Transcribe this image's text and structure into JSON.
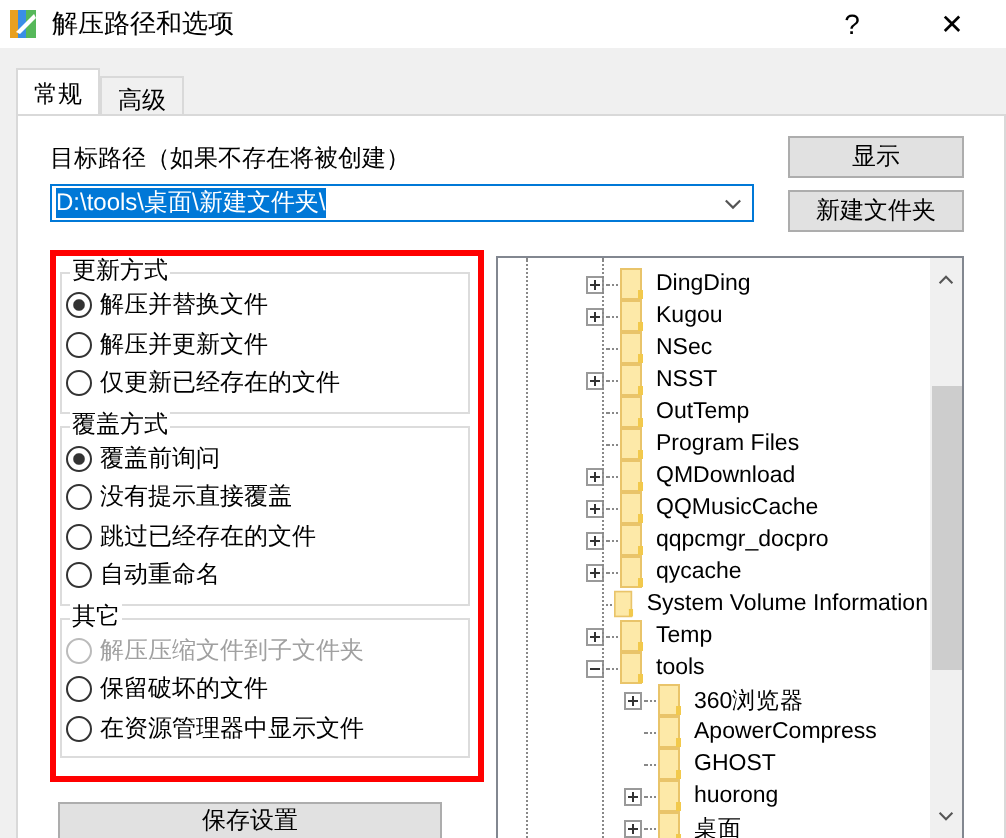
{
  "window": {
    "title": "解压路径和选项",
    "help": "?",
    "close": "✕"
  },
  "tabs": [
    {
      "label": "常规",
      "selected": true
    },
    {
      "label": "高级",
      "selected": false
    }
  ],
  "path": {
    "label": "目标路径（如果不存在将被创建）",
    "value": "D:\\tools\\桌面\\新建文件夹\\"
  },
  "buttons": [
    "显示",
    "新建文件夹"
  ],
  "groups": [
    {
      "title": "更新方式",
      "options": [
        {
          "label": "解压并替换文件",
          "selected": true,
          "disabled": false
        },
        {
          "label": "解压并更新文件",
          "selected": false,
          "disabled": false
        },
        {
          "label": "仅更新已经存在的文件",
          "selected": false,
          "disabled": false
        }
      ]
    },
    {
      "title": "覆盖方式",
      "options": [
        {
          "label": "覆盖前询问",
          "selected": true,
          "disabled": false
        },
        {
          "label": "没有提示直接覆盖",
          "selected": false,
          "disabled": false
        },
        {
          "label": "跳过已经存在的文件",
          "selected": false,
          "disabled": false
        },
        {
          "label": "自动重命名",
          "selected": false,
          "disabled": false
        }
      ]
    },
    {
      "title": "其它",
      "options": [
        {
          "label": "解压压缩文件到子文件夹",
          "selected": false,
          "disabled": true
        },
        {
          "label": "保留破坏的文件",
          "selected": false,
          "disabled": false
        },
        {
          "label": "在资源管理器中显示文件",
          "selected": false,
          "disabled": false
        }
      ]
    }
  ],
  "save_button": "保存设置",
  "tree": [
    {
      "label": "DingDing",
      "kind": "collapsed"
    },
    {
      "label": "Kugou",
      "kind": "collapsed"
    },
    {
      "label": "NSec",
      "kind": "leaf"
    },
    {
      "label": "NSST",
      "kind": "collapsed"
    },
    {
      "label": "OutTemp",
      "kind": "leaf"
    },
    {
      "label": "Program Files",
      "kind": "leaf"
    },
    {
      "label": "QMDownload",
      "kind": "collapsed"
    },
    {
      "label": "QQMusicCache",
      "kind": "collapsed"
    },
    {
      "label": "qqpcmgr_docpro",
      "kind": "collapsed"
    },
    {
      "label": "qycache",
      "kind": "collapsed"
    },
    {
      "label": "System Volume Information",
      "kind": "leaf"
    },
    {
      "label": "Temp",
      "kind": "collapsed"
    },
    {
      "label": "tools",
      "kind": "expanded",
      "children": [
        {
          "label": "360浏览器",
          "kind": "collapsed"
        },
        {
          "label": "ApowerCompress",
          "kind": "leaf"
        },
        {
          "label": "GHOST",
          "kind": "leaf"
        },
        {
          "label": "huorong",
          "kind": "collapsed"
        },
        {
          "label": "桌面",
          "kind": "collapsed"
        }
      ]
    }
  ]
}
